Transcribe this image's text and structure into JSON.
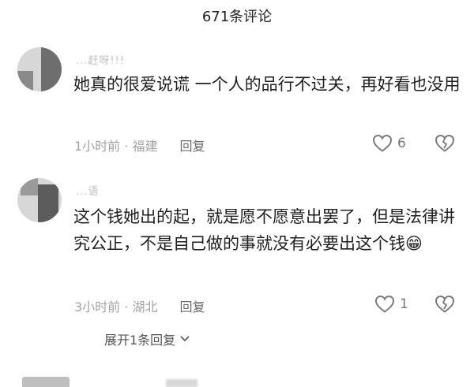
{
  "header": {
    "title": "671条评论"
  },
  "comments": [
    {
      "username": "...赶呀!!!",
      "text": "她真的很爱说谎 一个人的品行不过关，再好看也没用",
      "time_location": "1小时前 · 福建",
      "reply_label": "回复",
      "likes": "6"
    },
    {
      "username": "...语",
      "text": "这个钱她出的起，就是愿不愿意出罢了，但是法律讲究公正，不是自己做的事就没有必要出这个钱",
      "emoji": "😁",
      "time_location": "3小时前 · 湖北",
      "reply_label": "回复",
      "likes": "1",
      "expand_label": "展开1条回复"
    }
  ],
  "icons": {
    "like": "heart-outline-icon",
    "dislike": "broken-heart-icon",
    "expand": "chevron-down-icon"
  },
  "colors": {
    "meta": "#a3a3a3",
    "text": "#1f1f1f"
  }
}
